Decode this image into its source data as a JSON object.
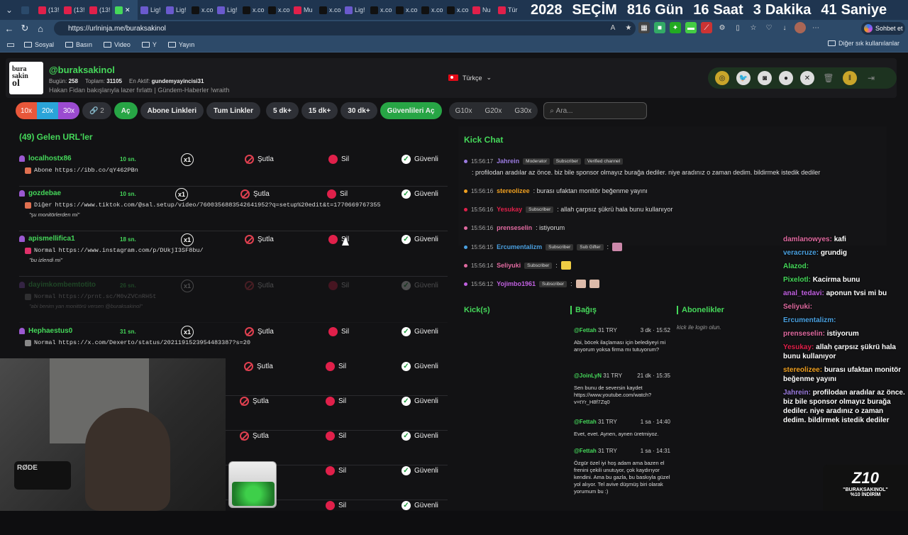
{
  "browser": {
    "tabs": [
      {
        "label": "",
        "color": "#2b4a6b"
      },
      {
        "label": "(13!",
        "color": "#e0204a"
      },
      {
        "label": "(13!",
        "color": "#e0204a"
      },
      {
        "label": "(13!",
        "color": "#e0204a"
      },
      {
        "label": "",
        "color": "#45d85a",
        "active": true
      },
      {
        "label": "Lig!",
        "color": "#6a5acd"
      },
      {
        "label": "Lig!",
        "color": "#6a5acd"
      },
      {
        "label": "x.co",
        "color": "#111"
      },
      {
        "label": "Lig!",
        "color": "#6a5acd"
      },
      {
        "label": "x.co",
        "color": "#111"
      },
      {
        "label": "x.co",
        "color": "#111"
      },
      {
        "label": "Mu",
        "color": "#e0204a"
      },
      {
        "label": "x.co",
        "color": "#111"
      },
      {
        "label": "Lig!",
        "color": "#6a5acd"
      },
      {
        "label": "x.co",
        "color": "#111"
      },
      {
        "label": "x.co",
        "color": "#111"
      },
      {
        "label": "x.co",
        "color": "#111"
      },
      {
        "label": "x.co",
        "color": "#111"
      },
      {
        "label": "Nu",
        "color": "#e0204a"
      },
      {
        "label": "Tür",
        "color": "#e0204a"
      }
    ],
    "countdown": {
      "year": "2028",
      "label": "SEÇİM",
      "days": "816",
      "days_label": "Gün",
      "hours": "16",
      "hours_label": "Saat",
      "minutes": "3",
      "minutes_label": "Dakika",
      "seconds": "41",
      "seconds_label": "Saniye"
    },
    "url": "https://urlninja.me/buraksakinol",
    "copilot_label": "Sohbet et",
    "bookmarks": [
      "Sosyal",
      "Basın",
      "Video",
      "Y",
      "Yayın"
    ],
    "bookmarks_right": "Diğer sık kullanılanlar"
  },
  "header": {
    "logo_lines": [
      "bura",
      "sakin",
      "ol"
    ],
    "username": "@buraksakinol",
    "today_label": "Bugün:",
    "today": "258",
    "total_label": "Toplam:",
    "total": "31105",
    "active_label": "En Aktif:",
    "active": "gundemyayincisi31",
    "stream_title": "Hakan Fidan bakışlarıyla lazer fırlattı | Gündem-Haberler !wraith",
    "language": "Türkçe"
  },
  "toolbar": {
    "mult": [
      "10x",
      "20x",
      "30x"
    ],
    "link_count": "2",
    "open": "Aç",
    "subscriber_links": "Abone Linkleri",
    "all_links": "Tum Linkler",
    "t5": "5 dk+",
    "t15": "15 dk+",
    "t30": "30 dk+",
    "open_safe": "Güvenlileri Aç",
    "g10": "G10x",
    "g20": "G20x",
    "g30": "G30x",
    "search_placeholder": "Ara..."
  },
  "list": {
    "title": "(49) Gelen URL'ler",
    "ban_label": "Şutla",
    "delete_label": "Sil",
    "safe_label": "Güvenli",
    "rows": [
      {
        "user": "localhostx86",
        "time": "10 sn.",
        "count": "x1",
        "type": "Abone",
        "link": "https://ibb.co/qY462PBn",
        "note": "",
        "icon": "#e07050"
      },
      {
        "user": "gozdebae",
        "time": "10 sn.",
        "count": "x1",
        "type": "Diğer",
        "link": "https://www.tiktok.com/@sal.setup/video/7600356883542641952?q=setup%20edit&t=1770669767355",
        "note": "\"şu monitörlerden mi\"",
        "icon": "#e07050"
      },
      {
        "user": "apismellifica1",
        "time": "18 sn.",
        "count": "x1",
        "type": "Normal",
        "link": "https://www.instagram.com/p/DUkjI3SF8bu/",
        "note": "\"bu izlendi mi\"",
        "icon": "#e0306a"
      },
      {
        "user": "dayimkombemtotito",
        "time": "26 sn.",
        "count": "x1",
        "type": "Normal",
        "link": "https://prnt.sc/M0vZVCnRH5t",
        "note": "\"abi benim yan monitörü versen @buraksakinol\"",
        "icon": "#888"
      },
      {
        "user": "Hephaestus0",
        "time": "31 sn.",
        "count": "x1",
        "type": "Normal",
        "link": "https://x.com/Dexerto/status/2021191523954483387?s=20",
        "note": "",
        "icon": "#888"
      }
    ]
  },
  "kick_chat": {
    "title": "Kick Chat",
    "messages": [
      {
        "time": "15:56:17",
        "name": "Jahrein",
        "badges": [
          "Moderator",
          "Subscriber",
          "Verified channel"
        ],
        "text": ": profilodan aradılar az önce. biz bile sponsor olmayız burağa dediler. niye aradınız o zaman dedim. bildirmek istedik dediler",
        "color": "#9b7be0"
      },
      {
        "time": "15:56:16",
        "name": "stereolizee",
        "badges": [],
        "text": ": burası ufaktan monitör beğenme yayını",
        "color": "#f0a020"
      },
      {
        "time": "15:56:16",
        "name": "Yesukay",
        "badges": [
          "Subscriber"
        ],
        "text": ": allah çarpsız şükrü hala bunu kullanıyor",
        "color": "#e0204a"
      },
      {
        "time": "15:56:16",
        "name": "prenseselin",
        "badges": [],
        "text": ": istiyorum",
        "color": "#e06aa0"
      },
      {
        "time": "15:56:15",
        "name": "Ercumentalizm",
        "badges": [
          "Subscriber",
          "Sub Gifter"
        ],
        "text": ":",
        "color": "#4aa0e0"
      },
      {
        "time": "15:56:14",
        "name": "Seliyuki",
        "badges": [
          "Subscriber"
        ],
        "text": ":",
        "color": "#e06aa0"
      },
      {
        "time": "15:56:12",
        "name": "Yojimbo1961",
        "badges": [
          "Subscriber"
        ],
        "text": ":",
        "color": "#c060e0"
      }
    ]
  },
  "sections": {
    "kicks": "Kick(s)",
    "donations": "Bağış",
    "subscribers": "Abonelikler",
    "login_note": "kick ile login olun."
  },
  "donations": [
    {
      "name": "@Fettah",
      "amount": "31 TRY",
      "time": "3 dk · 15:52",
      "text": "Abi, böcek ilaçlaması için belediyeyi mi arıyorum yoksa firma mı tutuyorum?"
    },
    {
      "name": "@JoinLyN",
      "amount": "31 TRY",
      "time": "21 dk · 15:35",
      "text": "Sen bunu de seversin kaydet https://www.youtube.com/watch?v=tYr_H8f7Zq0"
    },
    {
      "name": "@Fettah",
      "amount": "31 TRY",
      "time": "1 sa · 14:40",
      "text": "Evet, evet. Aynen, aynen üretmiyoz."
    },
    {
      "name": "@Fettah",
      "amount": "31 TRY",
      "time": "1 sa · 14:31",
      "text": "Özgür özel iyi hoş adam ama bazen el frenini çekili unutuyor, çok kaydırıyor kendini. Ama bu gazla, bu baskıyla güzel yol alıyor. Tel avive düşmüş biri olarak yorumum bu :)"
    }
  ],
  "overlay_chat": [
    {
      "name": "damlanowyes:",
      "text": "kafi",
      "color": "#e06aa0"
    },
    {
      "name": "veracruze:",
      "text": "grundig",
      "color": "#4aa0e0"
    },
    {
      "name": "Alazod:",
      "text": "",
      "color": "#45d85a"
    },
    {
      "name": "Pixelotl:",
      "text": "Kacirma bunu",
      "color": "#45d85a"
    },
    {
      "name": "anal_tedavi:",
      "text": "aponun tvsi mi bu",
      "color": "#c060e0"
    },
    {
      "name": "Yesukay:",
      "text": "allah çarpsız şükrü hala bunu kullanıyor",
      "color": "#e0204a"
    },
    {
      "name": "stereolizee:",
      "text": "burası ufaktan monitör beğenme yayını",
      "color": "#f0a020"
    },
    {
      "name": "Jahrein:",
      "text": "profilodan aradılar az önce. biz bile sponsor olmayız burağa dediler. niye aradınız o zaman dedim. bildirmek istedik dediler",
      "color": "#9b7be0"
    }
  ],
  "overlay_extra": [
    {
      "name": "Seliyuki:",
      "text": "",
      "color": "#e06aa0"
    },
    {
      "name": "Ercumentalizm:",
      "text": "",
      "color": "#4aa0e0"
    },
    {
      "name": "prenseselin:",
      "text": "istiyorum",
      "color": "#e06aa0"
    }
  ],
  "stream": {
    "mic_label": "RØDE",
    "promo_big": "Z10",
    "promo_line1": "\"BURAKSAKINOL\"",
    "promo_line2": "%10 İNDİRİM"
  }
}
